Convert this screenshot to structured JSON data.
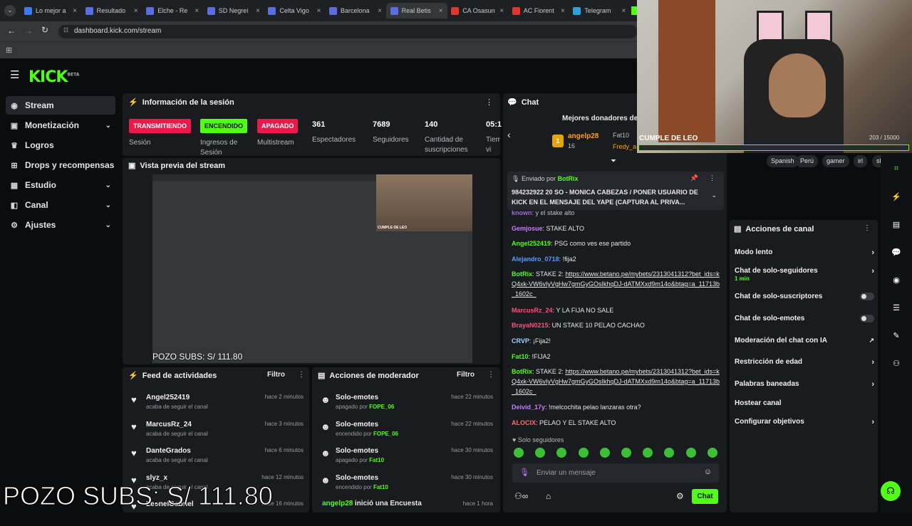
{
  "browser": {
    "tabs": [
      {
        "label": "Lo mejor a",
        "color": "#3c7cf0"
      },
      {
        "label": "Resultado",
        "color": "#5b6ee1"
      },
      {
        "label": "Elche - Re",
        "color": "#5b6ee1"
      },
      {
        "label": "SD Negrei",
        "color": "#5b6ee1"
      },
      {
        "label": "Celta Vigo",
        "color": "#5b6ee1"
      },
      {
        "label": "Barcelona",
        "color": "#5b6ee1"
      },
      {
        "label": "Real Betis",
        "color": "#5b6ee1"
      },
      {
        "label": "CA Osasun",
        "color": "#e0362d"
      },
      {
        "label": "AC Fiorent",
        "color": "#e0362d"
      },
      {
        "label": "Telegram",
        "color": "#2aa3e0"
      }
    ],
    "url": "dashboard.kick.com/stream"
  },
  "brand": {
    "logo": "KICK",
    "logo_sup": "BETA",
    "accent": "#53fc18"
  },
  "sidebar": {
    "items": [
      {
        "label": "Stream",
        "icon": "broadcast-icon"
      },
      {
        "label": "Monetización",
        "icon": "wallet-icon"
      },
      {
        "label": "Logros",
        "icon": "trophy-icon"
      },
      {
        "label": "Drops y recompensas",
        "icon": "gift-icon"
      },
      {
        "label": "Estudio",
        "icon": "studio-icon"
      },
      {
        "label": "Canal",
        "icon": "channel-icon"
      },
      {
        "label": "Ajustes",
        "icon": "gear-icon"
      }
    ]
  },
  "session": {
    "title": "Información de la sesión",
    "transmitiendo": "TRANSMITIENDO",
    "encendido": "ENCENDIDO",
    "apagado": "APAGADO",
    "sesion": "Sesión",
    "ingresos": "Ingresos de Sesión",
    "multistream": "Multistream",
    "espectadores_v": "361",
    "espectadores": "Espectadores",
    "seguidores_v": "7689",
    "seguidores": "Seguidores",
    "subs_v": "140",
    "subs": "Cantidad de suscripciones",
    "tiempo_v": "05:1",
    "tiempo": "Tiem vi"
  },
  "preview": {
    "title": "Vista previa del stream",
    "pozo": "POZO SUBS: S/ 111.80",
    "cam_label": "CUMPLE DE LEO"
  },
  "overlay": {
    "pozo_big": "POZO SUBS: S/ 111.80",
    "cumple": "CUMPLE DE LEO",
    "goal": "203 / 15000"
  },
  "feed": {
    "title": "Feed de actividades",
    "filter": "Filtro",
    "items": [
      {
        "name": "Angel252419",
        "sub": "acaba de seguir el canal",
        "time": "hace 2 minutos"
      },
      {
        "name": "MarcusRz_24",
        "sub": "acaba de seguir el canal",
        "time": "hace 3 minutos"
      },
      {
        "name": "DanteGrados",
        "sub": "acaba de seguir el canal",
        "time": "hace 6 minutos"
      },
      {
        "name": "slyz_x",
        "sub": "acaba de seguir el canal",
        "time": "hace 12 minutos"
      },
      {
        "name": "LeonelGabriel",
        "sub": "",
        "time": "hace 16 minutos"
      }
    ]
  },
  "mod": {
    "title": "Acciones de moderador",
    "filter": "Filtro",
    "items": [
      {
        "name": "Solo-emotes",
        "pre": "apagado por",
        "by": "FOPE_06",
        "time": "hace 22 minutos"
      },
      {
        "name": "Solo-emotes",
        "pre": "encendido por",
        "by": "FOPE_06",
        "time": "hace 22 minutos"
      },
      {
        "name": "Solo-emotes",
        "pre": "apagado por",
        "by": "Fat10",
        "time": "hace 30 minutos"
      },
      {
        "name": "Solo-emotes",
        "pre": "encendido por",
        "by": "Fat10",
        "time": "hace 30 minutos"
      }
    ],
    "poll_user": "angelp28",
    "poll_text": "inició una Encuesta",
    "poll_time": "hace 1 hora"
  },
  "chat": {
    "title": "Chat",
    "donors_title": "Mejores donadores de l",
    "donor1": "angelp28",
    "donor1_count": "16",
    "donor2": "Fat10",
    "donor3": "Fredy_a",
    "pinned_by": "Enviado por",
    "pinned_user": "BotRix",
    "pinned_text": "984232922 20 SO - MONICA CABEZAS / PONER USUARIO DE KICK EN EL MENSAJE DEL YAPE (CAPTURA AL PRIVA...",
    "messages": [
      {
        "user": "Gemjosue",
        "color": "#c77dff",
        "text": "STAKE ALTO"
      },
      {
        "user": "Angel252419",
        "color": "#53fc18",
        "text": "PSG como ves ese partido"
      },
      {
        "user": "Alejandro_0718",
        "color": "#4f9dff",
        "text": "!fija2"
      },
      {
        "user": "MarcusRz_24",
        "color": "#ff4f7b",
        "text": "Y LA FIJA NO SALE"
      },
      {
        "user": "BrayaN0215",
        "color": "#ff4f7b",
        "text": "UN STAKE 10 PELAO CACHAO"
      },
      {
        "user": "CRVP",
        "color": "#9fd3ff",
        "text": "¡Fija2!"
      },
      {
        "user": "Fat10",
        "color": "#53fc18",
        "text": "!FIJA2"
      },
      {
        "user": "Deivid_17y",
        "color": "#c77dff",
        "text": "!melcochita pelao lanzaras otra?"
      },
      {
        "user": "ALOCIX",
        "color": "#ff6b6b",
        "text": "PELAO Y EL STAKE ALTO"
      }
    ],
    "bot_user": "BotRix",
    "bot_text": "STAKE 2:",
    "bot_link": "https://www.betano.pe/mybets/2313041312?bet_ids=kQ4xk-VW6vIyVgHw7gmGyGOsIkhqDJ-dATMXxd9m14o&btag=a_11713b_1602c_",
    "prev_user": "known",
    "prev_text": "y el stake alto",
    "mode": "Solo seguidores",
    "placeholder": "Enviar un mensaje",
    "send": "Chat"
  },
  "right": {
    "tags": [
      "Spanish",
      "Perú",
      "gamer",
      "irl",
      "she"
    ],
    "title": "Acciones de canal",
    "items": [
      {
        "label": "Modo lento",
        "kind": "chev"
      },
      {
        "label": "Chat de solo-seguidores",
        "sub": "1 min",
        "kind": "chev"
      },
      {
        "label": "Chat de solo-suscriptores",
        "kind": "toggle"
      },
      {
        "label": "Chat de solo-emotes",
        "kind": "toggle"
      },
      {
        "label": "Moderación del chat con IA",
        "kind": "ext"
      },
      {
        "label": "Restricción de edad",
        "kind": "chev"
      },
      {
        "label": "Palabras baneadas",
        "kind": "chev"
      },
      {
        "label": "Hostear canal",
        "kind": "none"
      },
      {
        "label": "Configurar objetivos",
        "kind": "chev"
      }
    ]
  }
}
